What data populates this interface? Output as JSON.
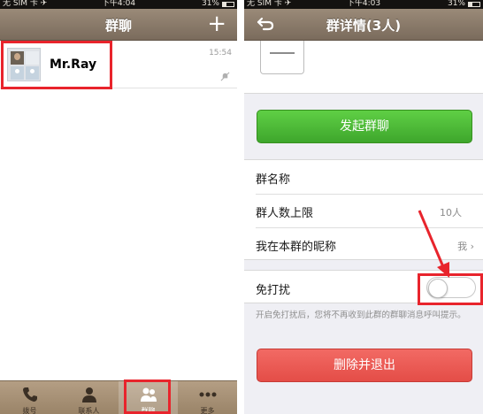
{
  "left_screen": {
    "status_bar": {
      "carrier": "无 SIM 卡 ✈",
      "time": "下午4:04",
      "battery": "31%"
    },
    "nav": {
      "title": "群聊",
      "add_label": "+"
    },
    "chat": {
      "name": "Mr.Ray",
      "time": "15:54"
    },
    "tabs": [
      {
        "label": "拨号",
        "icon": "phone-icon"
      },
      {
        "label": "联系人",
        "icon": "contacts-icon"
      },
      {
        "label": "群聊",
        "icon": "group-chat-icon"
      },
      {
        "label": "更多",
        "icon": "more-icon"
      }
    ]
  },
  "right_screen": {
    "status_bar": {
      "carrier": "无 SIM 卡 ✈",
      "time": "下午4:03",
      "battery": "31%"
    },
    "nav": {
      "title": "群详情(3人)"
    },
    "start_chat_button": "发起群聊",
    "rows": [
      {
        "label": "群名称",
        "value": ""
      },
      {
        "label": "群人数上限",
        "value": "10人"
      },
      {
        "label": "我在本群的昵称",
        "value": "我 ›"
      }
    ],
    "mute": {
      "label": "免打扰",
      "enabled": false
    },
    "hint": "开启免打扰后，您将不再收到此群的群聊消息呼叫提示。",
    "delete_button": "删除并退出"
  },
  "colors": {
    "nav_brown": "#8a7a69",
    "accent_green": "#4cb83a",
    "danger_red": "#ec5a54",
    "highlight_red": "#e8242c"
  }
}
